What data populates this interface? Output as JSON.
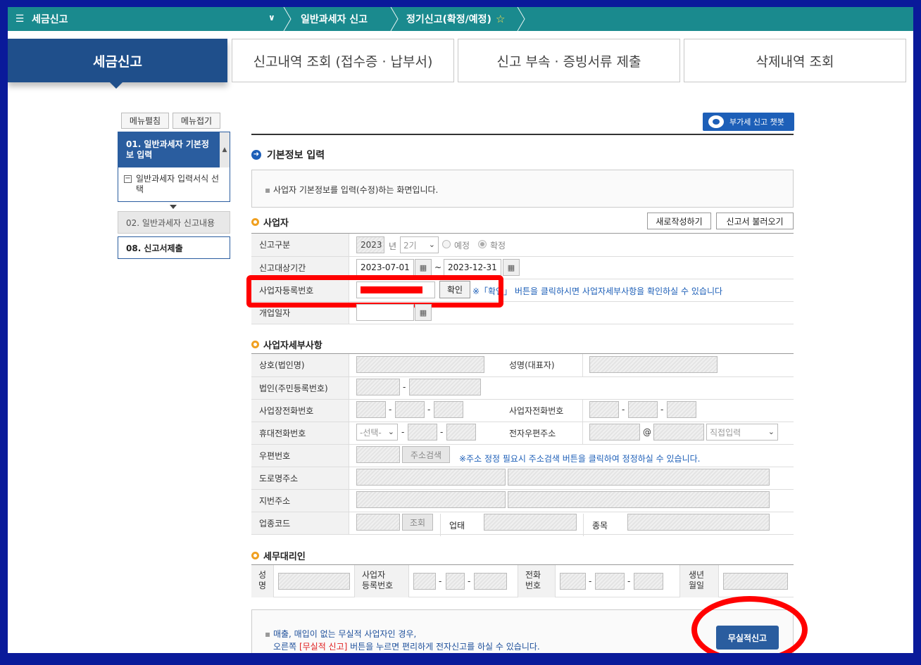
{
  "topbar": {
    "home": "세금신고",
    "crumb1": "일반과세자 신고",
    "crumb2": "정기신고(확정/예정)"
  },
  "tabs": [
    {
      "label": "세금신고"
    },
    {
      "label": "신고내역 조회 (접수증 · 납부서)"
    },
    {
      "label": "신고 부속 · 증빙서류 제출"
    },
    {
      "label": "삭제내역 조회"
    }
  ],
  "side": {
    "expand": "메뉴펼침",
    "collapse": "메뉴접기",
    "step1": "01. 일반과세자 기본정보 입력",
    "step1_sub": "일반과세자 입력서식 선택",
    "step2": "02. 일반과세자 신고내용",
    "step8": "08. 신고서제출"
  },
  "chatbot": "부가세 신고 챗봇",
  "section": {
    "title": "기본정보 입력",
    "desc": "사업자 기본정보를 입력(수정)하는 화면입니다."
  },
  "biz": {
    "title": "사업자",
    "new_btn": "새로작성하기",
    "load_btn": "신고서 불러오기",
    "type_label": "신고구분",
    "year": "2023",
    "year_unit": "년",
    "period": "2기",
    "radio_pre": "예정",
    "radio_final": "확정",
    "range_label": "신고대상기간",
    "date_from": "2023-07-01",
    "tilde": "~",
    "date_to": "2023-12-31",
    "regno_label": "사업자등록번호",
    "confirm_btn": "확인",
    "regno_note": "※「확인」 버튼을 클릭하시면 사업자세부사항을 확인하실 수 있습니다",
    "open_label": "개업일자"
  },
  "detail": {
    "title": "사업자세부사항",
    "name_label": "상호(법인명)",
    "rep_label": "성명(대표자)",
    "corp_label": "법인(주민등록번호)",
    "tel_label": "사업장전화번호",
    "bizphone_label": "사업자전화번호",
    "mobile_label": "휴대전화번호",
    "mobile_sel": "-선택-",
    "email_label": "전자우편주소",
    "at": "@",
    "email_sel": "직접입력",
    "zip_label": "우편번호",
    "addr_btn": "주소검색",
    "addr_note": "※주소 정정 필요시 주소검색 버튼을 클릭하여 정정하실 수 있습니다.",
    "road_label": "도로명주소",
    "lot_label": "지번주소",
    "code_label": "업종코드",
    "lookup_btn": "조회",
    "biztype_label": "업태",
    "item_label": "종목",
    "dash": "-"
  },
  "agent": {
    "title": "세무대리인",
    "name_l1": "성",
    "name_l2": "명",
    "reg_l1": "사업자",
    "reg_l2": "등록번호",
    "tel_l1": "전화",
    "tel_l2": "번호",
    "birth_l1": "생년",
    "birth_l2": "월일"
  },
  "bottom": {
    "line1": "매출, 매입이 없는 무실적 사업자인 경우,",
    "line2_a": "오른쪽 ",
    "line2_red": "[무실적 신고]",
    "line2_b": " 버튼을 누르면 편리하게 전자신고를 하실 수 있습니다.",
    "nul_btn": "무실적신고"
  }
}
